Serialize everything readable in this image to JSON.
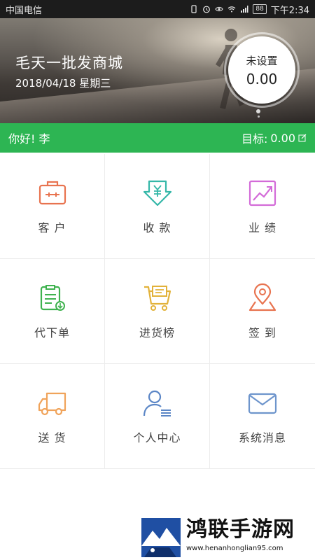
{
  "status_bar": {
    "carrier": "中国电信",
    "battery": "88",
    "time": "下午2:34"
  },
  "banner": {
    "store_name": "毛天一批发商城",
    "date": "2018/04/18 星期三",
    "target_label": "未设置",
    "target_value": "0.00"
  },
  "greeting_bar": {
    "greeting": "你好! 李",
    "goal_label": "目标:",
    "goal_value": "0.00",
    "color": "#2db553"
  },
  "menu": {
    "items": [
      {
        "label": "客 户",
        "icon": "briefcase-icon",
        "color": "#e8734f"
      },
      {
        "label": "收 款",
        "icon": "yuan-receive-icon",
        "color": "#35b7a8"
      },
      {
        "label": "业 绩",
        "icon": "trend-chart-icon",
        "color": "#d36bd8"
      },
      {
        "label": "代下单",
        "icon": "order-clipboard-icon",
        "color": "#3fb24f"
      },
      {
        "label": "进货榜",
        "icon": "shopping-cart-icon",
        "color": "#e2b23a"
      },
      {
        "label": "签 到",
        "icon": "location-pin-icon",
        "color": "#e8734f"
      },
      {
        "label": "送 货",
        "icon": "delivery-truck-icon",
        "color": "#f0a35a"
      },
      {
        "label": "个人中心",
        "icon": "user-profile-icon",
        "color": "#5b86c6"
      },
      {
        "label": "系统消息",
        "icon": "mail-envelope-icon",
        "color": "#6e95cc"
      }
    ]
  },
  "watermark": {
    "title": "鸿联手游网",
    "url": "www.henanhonglian95.com"
  }
}
